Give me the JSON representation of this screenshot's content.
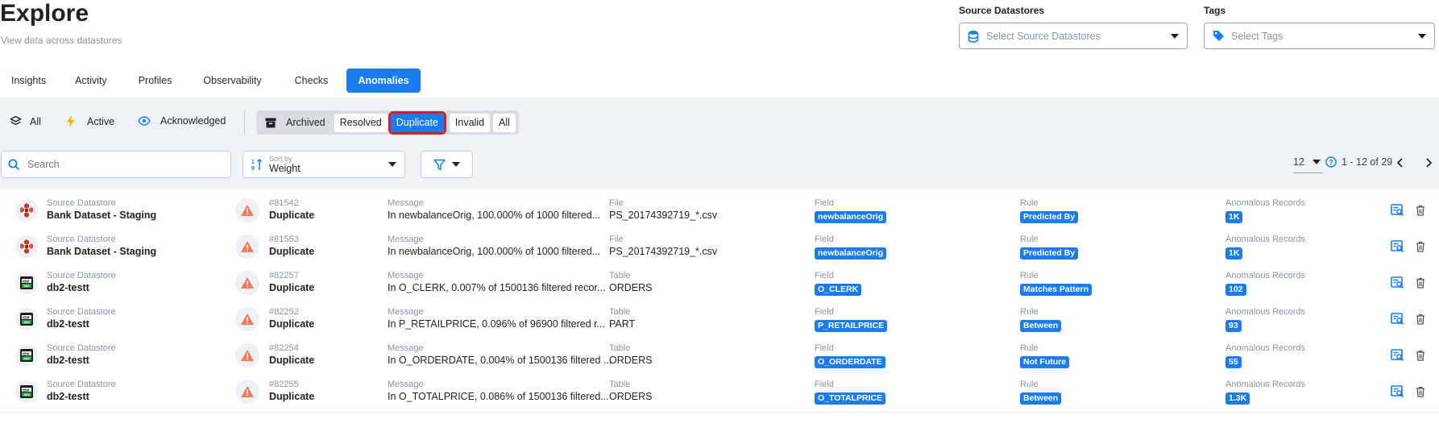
{
  "header": {
    "title": "Explore",
    "subtitle": "View data across datastores",
    "source_label": "Source Datastores",
    "source_placeholder": "Select Source Datastores",
    "tags_label": "Tags",
    "tags_placeholder": "Select Tags"
  },
  "tabs": [
    {
      "label": "Insights",
      "active": false
    },
    {
      "label": "Activity",
      "active": false
    },
    {
      "label": "Profiles",
      "active": false
    },
    {
      "label": "Observability",
      "active": false
    },
    {
      "label": "Checks",
      "active": false
    },
    {
      "label": "Anomalies",
      "active": true
    }
  ],
  "status_filters": {
    "all": "All",
    "active": "Active",
    "acknowledged": "Acknowledged"
  },
  "archived_filters": {
    "archived": "Archived",
    "resolved": "Resolved",
    "duplicate": "Duplicate",
    "invalid": "Invalid",
    "all": "All",
    "selected": "Duplicate"
  },
  "search": {
    "placeholder": "Search"
  },
  "sort": {
    "label": "Sort by",
    "value": "Weight"
  },
  "pagination": {
    "page_size": "12",
    "range": "1 - 12 of 29"
  },
  "columns": {
    "source": "Source Datastore",
    "message": "Message",
    "field": "Field",
    "rule": "Rule",
    "records": "Anomalous Records"
  },
  "rows": [
    {
      "source_type": "dataset",
      "source": "Bank Dataset - Staging",
      "id": "#81542",
      "status": "Duplicate",
      "message": "In newbalanceOrig, 100.000% of 1000 filtered...",
      "container_label": "File",
      "container": "PS_20174392719_*.csv",
      "field": "newbalanceOrig",
      "rule": "Predicted By",
      "records": "1K"
    },
    {
      "source_type": "dataset",
      "source": "Bank Dataset - Staging",
      "id": "#81553",
      "status": "Duplicate",
      "message": "In newbalanceOrig, 100.000% of 1000 filtered...",
      "container_label": "File",
      "container": "PS_20174392719_*.csv",
      "field": "newbalanceOrig",
      "rule": "Predicted By",
      "records": "1K"
    },
    {
      "source_type": "db2",
      "source": "db2-testt",
      "id": "#82257",
      "status": "Duplicate",
      "message": "In O_CLERK, 0.007% of 1500136 filtered recor...",
      "container_label": "Table",
      "container": "ORDERS",
      "field": "O_CLERK",
      "rule": "Matches Pattern",
      "records": "102"
    },
    {
      "source_type": "db2",
      "source": "db2-testt",
      "id": "#82252",
      "status": "Duplicate",
      "message": "In P_RETAILPRICE, 0.096% of 96900 filtered r...",
      "container_label": "Table",
      "container": "PART",
      "field": "P_RETAILPRICE",
      "rule": "Between",
      "records": "93"
    },
    {
      "source_type": "db2",
      "source": "db2-testt",
      "id": "#82254",
      "status": "Duplicate",
      "message": "In O_ORDERDATE, 0.004% of 1500136 filtered ...",
      "container_label": "Table",
      "container": "ORDERS",
      "field": "O_ORDERDATE",
      "rule": "Not Future",
      "records": "55"
    },
    {
      "source_type": "db2",
      "source": "db2-testt",
      "id": "#82255",
      "status": "Duplicate",
      "message": "In O_TOTALPRICE, 0.086% of 1500136 filtered...",
      "container_label": "Table",
      "container": "ORDERS",
      "field": "O_TOTALPRICE",
      "rule": "Between",
      "records": "1.3K"
    }
  ],
  "colors": {
    "accent": "#1a7cf0",
    "highlight_border": "#d62027",
    "warning": "#f07a5a"
  }
}
